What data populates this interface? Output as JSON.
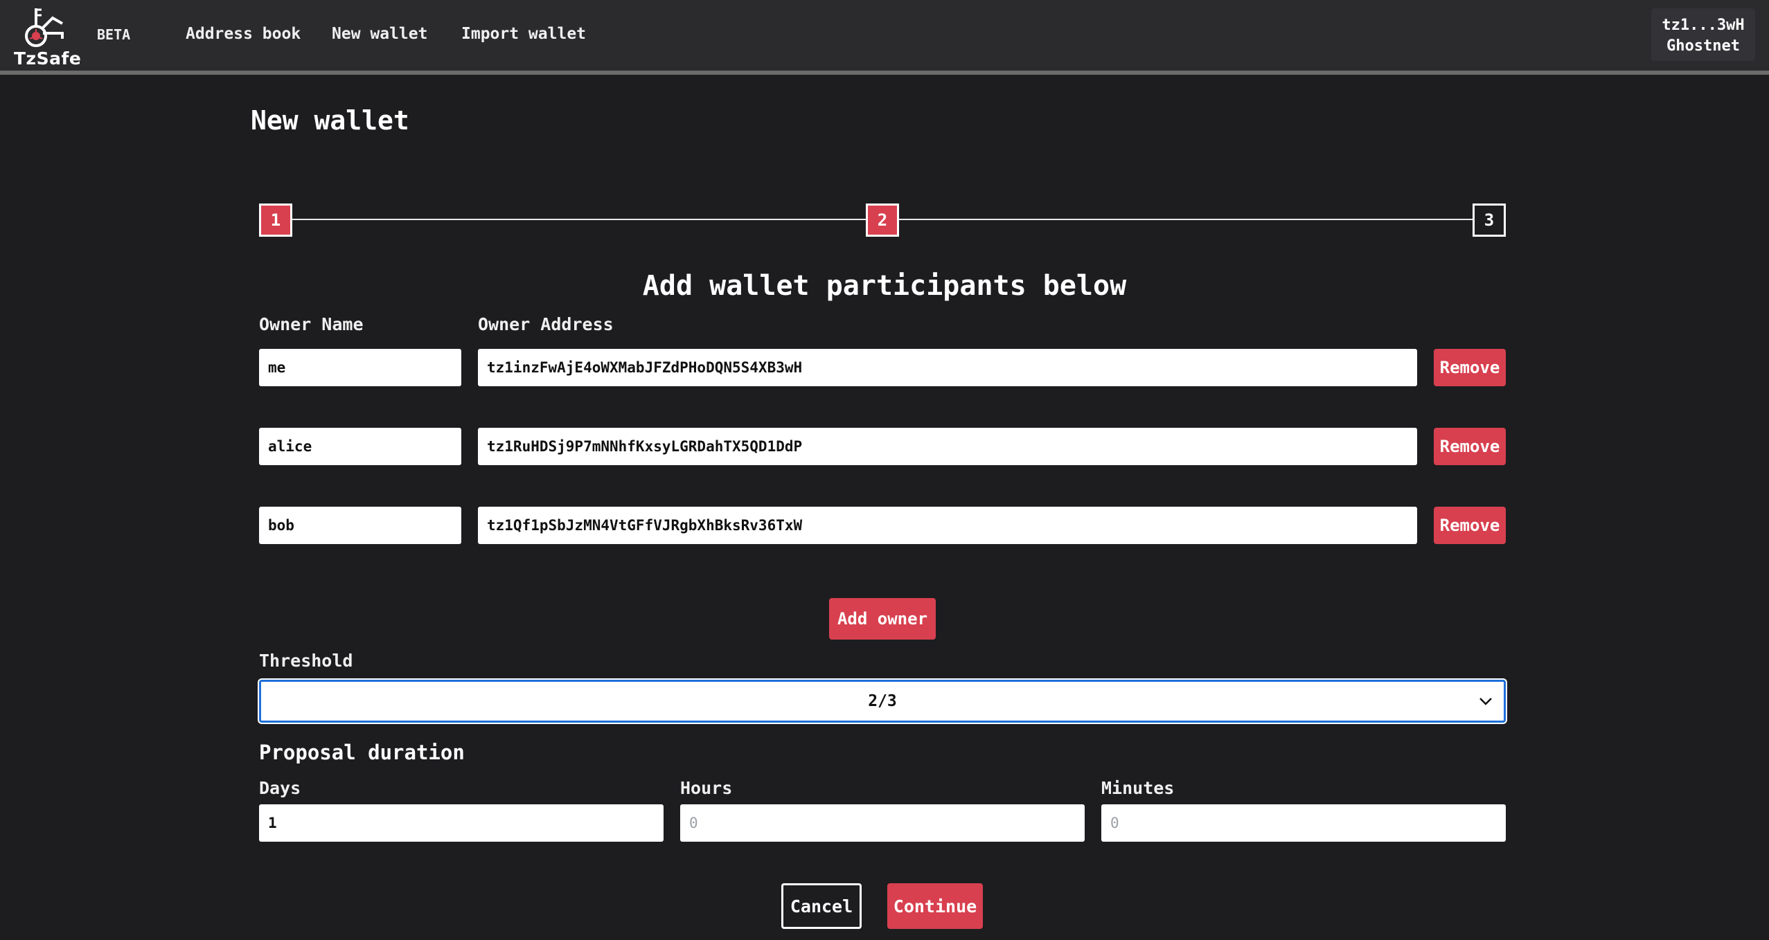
{
  "header": {
    "logo_text": "TzSafe",
    "beta_label": "BETA",
    "nav": [
      {
        "label": "Address book"
      },
      {
        "label": "New wallet"
      },
      {
        "label": "Import wallet"
      }
    ],
    "account": {
      "address": "tz1...3wH",
      "network": "Ghostnet"
    }
  },
  "page": {
    "title": "New wallet",
    "steps": [
      {
        "label": "1",
        "state": "done"
      },
      {
        "label": "2",
        "state": "active"
      },
      {
        "label": "3",
        "state": "pending"
      }
    ],
    "section_title": "Add wallet participants below",
    "owner_name_header": "Owner Name",
    "owner_address_header": "Owner Address",
    "owners": [
      {
        "name": "me",
        "address": "tz1inzFwAjE4oWXMabJFZdPHoDQN5S4XB3wH",
        "remove_label": "Remove"
      },
      {
        "name": "alice",
        "address": "tz1RuHDSj9P7mNNhfKxsyLGRDahTX5QD1DdP",
        "remove_label": "Remove"
      },
      {
        "name": "bob",
        "address": "tz1Qf1pSbJzMN4VtGFfVJRgbXhBksRv36TxW",
        "remove_label": "Remove"
      }
    ],
    "add_owner_label": "Add owner",
    "threshold": {
      "label": "Threshold",
      "value": "2/3"
    },
    "proposal_duration": {
      "title": "Proposal duration",
      "days": {
        "label": "Days",
        "value": "1"
      },
      "hours": {
        "label": "Hours",
        "placeholder": "0"
      },
      "minutes": {
        "label": "Minutes",
        "placeholder": "0"
      }
    },
    "cancel_label": "Cancel",
    "continue_label": "Continue"
  },
  "colors": {
    "background": "#1d1d20",
    "header": "#2b2b2e",
    "accent": "#d8404f",
    "focus": "#1e6fd9"
  }
}
